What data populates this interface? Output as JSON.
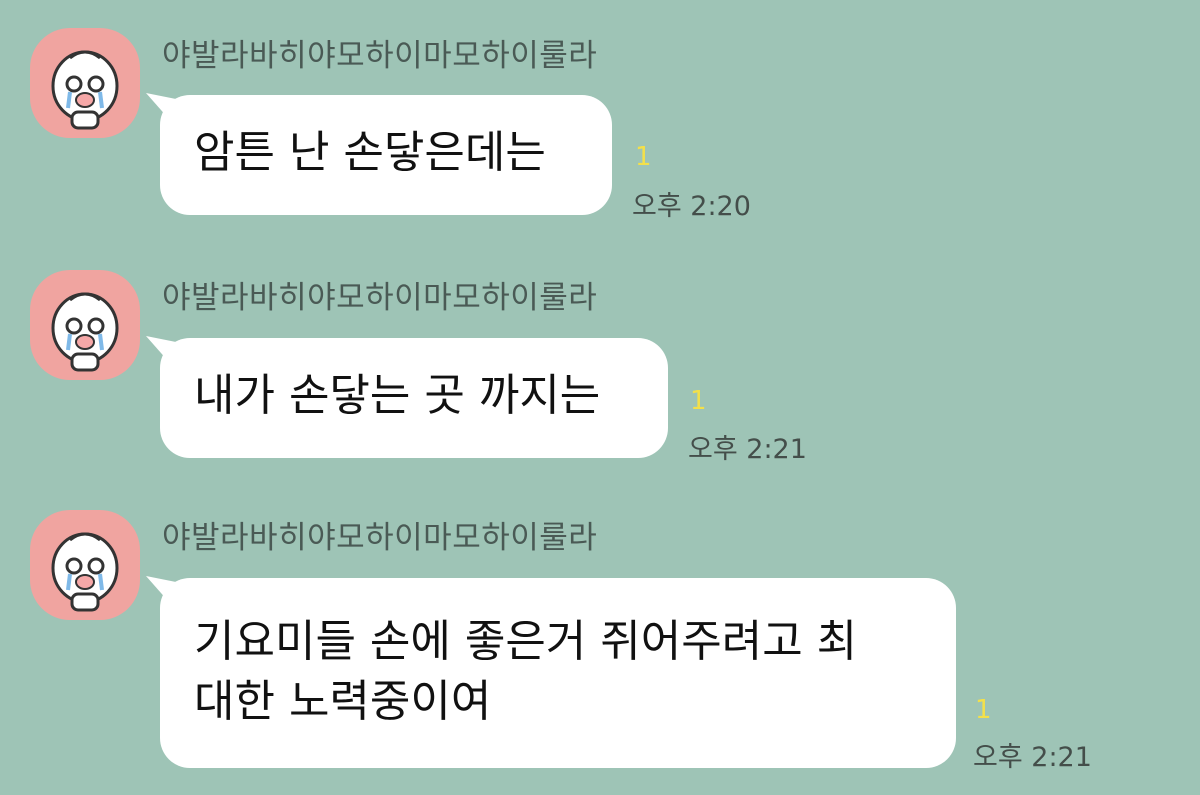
{
  "messages": [
    {
      "sender": "야발라바히야모하이마모하이룰라",
      "text": "암튼 난 손닿은데는",
      "unread": "1",
      "time": "오후 2:20",
      "avatar": "crying-peach-avatar-icon"
    },
    {
      "sender": "야발라바히야모하이마모하이룰라",
      "text": "내가 손닿는 곳 까지는",
      "unread": "1",
      "time": "오후 2:21",
      "avatar": "crying-peach-avatar-icon"
    },
    {
      "sender": "야발라바히야모하이마모하이룰라",
      "text": "기요미들 손에 좋은거 쥐어주려고 최\n대한 노력중이여",
      "unread": "1",
      "time": "오후 2:21",
      "avatar": "crying-peach-avatar-icon"
    }
  ],
  "colors": {
    "chat_background": "#9ec4b6",
    "bubble": "#ffffff",
    "avatar_background": "#f0a4a0",
    "unread_count": "#f3e04a"
  }
}
